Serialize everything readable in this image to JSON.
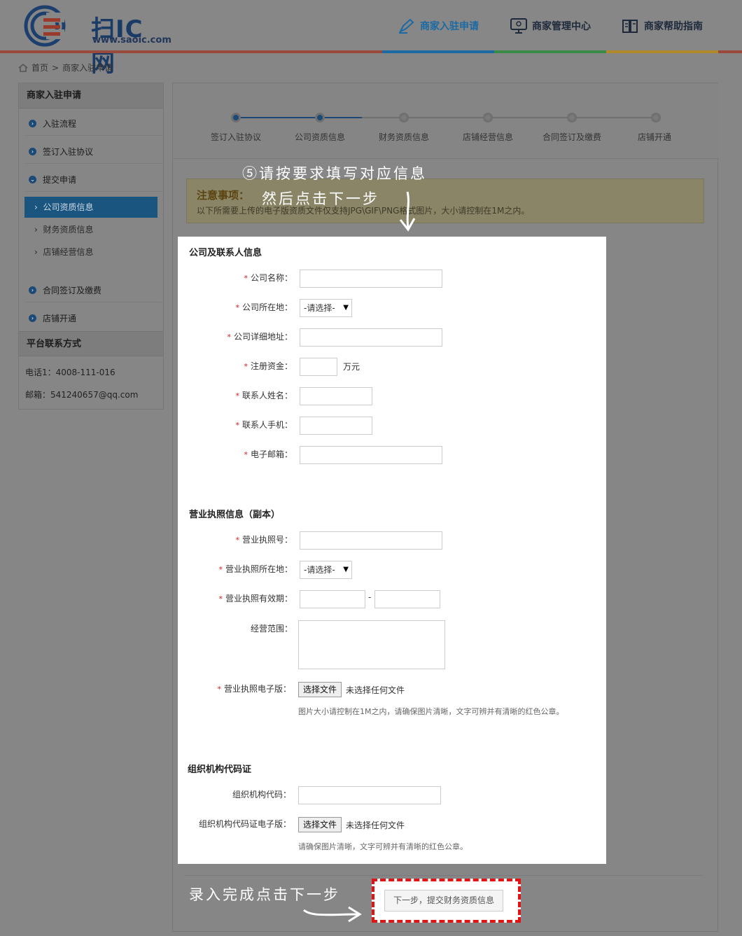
{
  "header": {
    "logo_text": "扫IC网",
    "logo_url": "www.saoic.com",
    "nav": [
      {
        "label": "商家入驻申请",
        "icon": "pen-icon",
        "active": true
      },
      {
        "label": "商家管理中心",
        "icon": "monitor-icon",
        "active": false
      },
      {
        "label": "商家帮助指南",
        "icon": "book-icon",
        "active": false
      }
    ]
  },
  "breadcrumb": {
    "home": "首页",
    "sep": ">",
    "current": "商家入驻申请"
  },
  "sidebar": {
    "title": "商家入驻申请",
    "items": [
      {
        "label": "入驻流程",
        "icon": "chevron-right-icon"
      },
      {
        "label": "签订入驻协议",
        "icon": "chevron-right-icon"
      },
      {
        "label": "提交申请",
        "icon": "chevron-down-icon"
      }
    ],
    "sub_items": [
      {
        "label": "公司资质信息",
        "active": true
      },
      {
        "label": "财务资质信息",
        "active": false
      },
      {
        "label": "店铺经营信息",
        "active": false
      }
    ],
    "items2": [
      {
        "label": "合同签订及缴费"
      },
      {
        "label": "店铺开通"
      }
    ],
    "contact_title": "平台联系方式",
    "phone": "电话1：4008-111-016",
    "email": "邮箱：541240657@qq.com"
  },
  "steps": [
    {
      "label": "签订入驻协议",
      "done": true
    },
    {
      "label": "公司资质信息",
      "done": true
    },
    {
      "label": "财务资质信息",
      "done": false
    },
    {
      "label": "店铺经营信息",
      "done": false
    },
    {
      "label": "合同签订及缴费",
      "done": false
    },
    {
      "label": "店铺开通",
      "done": false
    }
  ],
  "notice": {
    "title": "注意事项：",
    "text": "以下所需要上传的电子版资质文件仅支持JPG\\GIF\\PNG格式图片，大小请控制在1M之内。"
  },
  "form": {
    "section1": "公司及联系人信息",
    "company_name": "公司名称：",
    "company_location": "公司所在地：",
    "company_address": "公司详细地址：",
    "capital": "注册资金：",
    "capital_unit": "万元",
    "contact_name": "联系人姓名：",
    "contact_phone": "联系人手机：",
    "email": "电子邮箱：",
    "select_placeholder": "-请选择-",
    "section2": "营业执照信息（副本）",
    "license_no": "营业执照号：",
    "license_location": "营业执照所在地：",
    "license_period": "营业执照有效期：",
    "period_sep": "-",
    "business_scope": "经营范围：",
    "license_file": "营业执照电子版：",
    "file_button": "选择文件",
    "file_none": "未选择任何文件",
    "license_hint": "图片大小请控制在1M之内，请确保图片清晰，文字可辨并有清晰的红色公章。",
    "section3": "组织机构代码证",
    "org_code": "组织机构代码：",
    "org_file": "组织机构代码证电子版：",
    "org_hint": "请确保图片清晰，文字可辨并有清晰的红色公章。"
  },
  "next_button": "下一步，提交财务资质信息",
  "annotations": {
    "top_line1": "⑤请按要求填写对应信息",
    "top_line2": "然后点击下一步",
    "bottom": "录入完成点击下一步"
  },
  "colors": {
    "brand_blue": "#1c6aa4",
    "highlight_red": "#e01414",
    "required_star": "#d41c1c"
  }
}
